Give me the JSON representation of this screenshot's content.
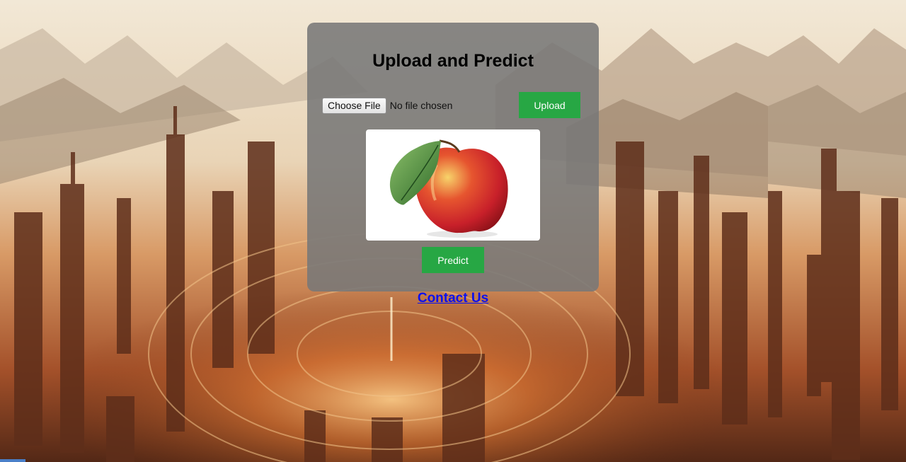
{
  "page": {
    "title": "Upload and Predict"
  },
  "upload_form": {
    "choose_file_label": "Choose File",
    "file_status": "No file chosen",
    "upload_label": "Upload"
  },
  "preview": {
    "image_subject": "apple"
  },
  "actions": {
    "predict_label": "Predict"
  },
  "footer": {
    "contact_label": "Contact Us"
  },
  "colors": {
    "button_green": "#27a744",
    "link_blue": "#0b10ee",
    "card_gray": "#787878"
  }
}
